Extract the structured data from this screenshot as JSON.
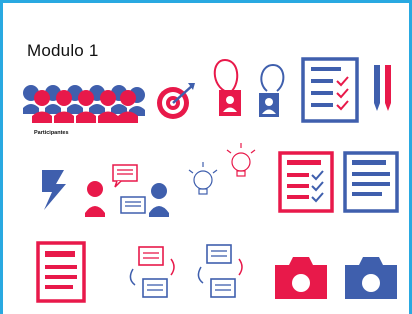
{
  "title": "Modulo 1",
  "participants_label": "Participantes",
  "colors": {
    "red": "#e8194a",
    "blue": "#3f5fad",
    "frame": "#29a9e1"
  },
  "icons": [
    "participants-group-icon",
    "target-icon",
    "badge-red-icon",
    "badge-blue-icon",
    "checklist-icon",
    "pencils-icon",
    "lightning-icon",
    "conversation-icon",
    "lightbulbs-icon",
    "checklist-red-icon",
    "document-blue-icon",
    "document-red-icon",
    "exchange-red-icon",
    "exchange-blue-icon",
    "camera-red-icon",
    "camera-blue-icon"
  ]
}
